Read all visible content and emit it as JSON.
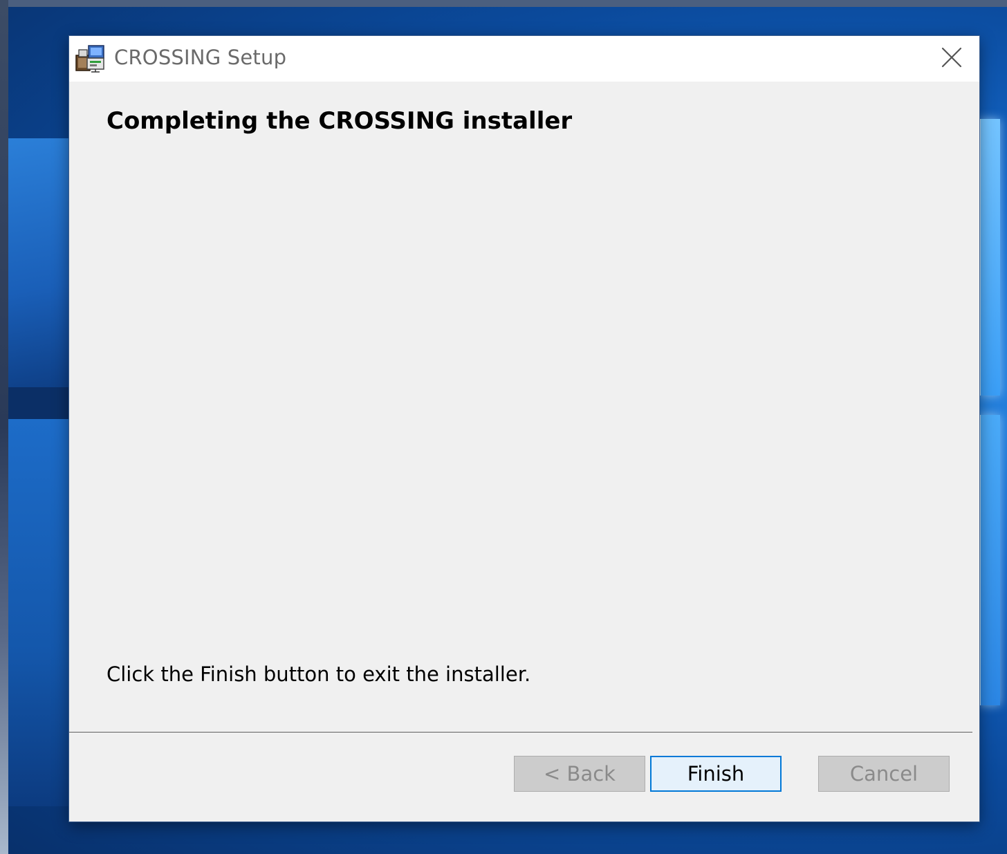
{
  "window": {
    "title": "CROSSING Setup",
    "icon": "installer-package-icon",
    "close_icon": "close-icon"
  },
  "content": {
    "heading": "Completing the CROSSING installer",
    "message": "Click the Finish button to exit the installer."
  },
  "buttons": {
    "back": {
      "label": "< Back",
      "enabled": false
    },
    "finish": {
      "label": "Finish",
      "enabled": true,
      "focused": true
    },
    "cancel": {
      "label": "Cancel",
      "enabled": false
    }
  },
  "colors": {
    "focus_border": "#0078d7",
    "dialog_bg": "#f0f0f0",
    "disabled_text": "#8a8a8a"
  }
}
